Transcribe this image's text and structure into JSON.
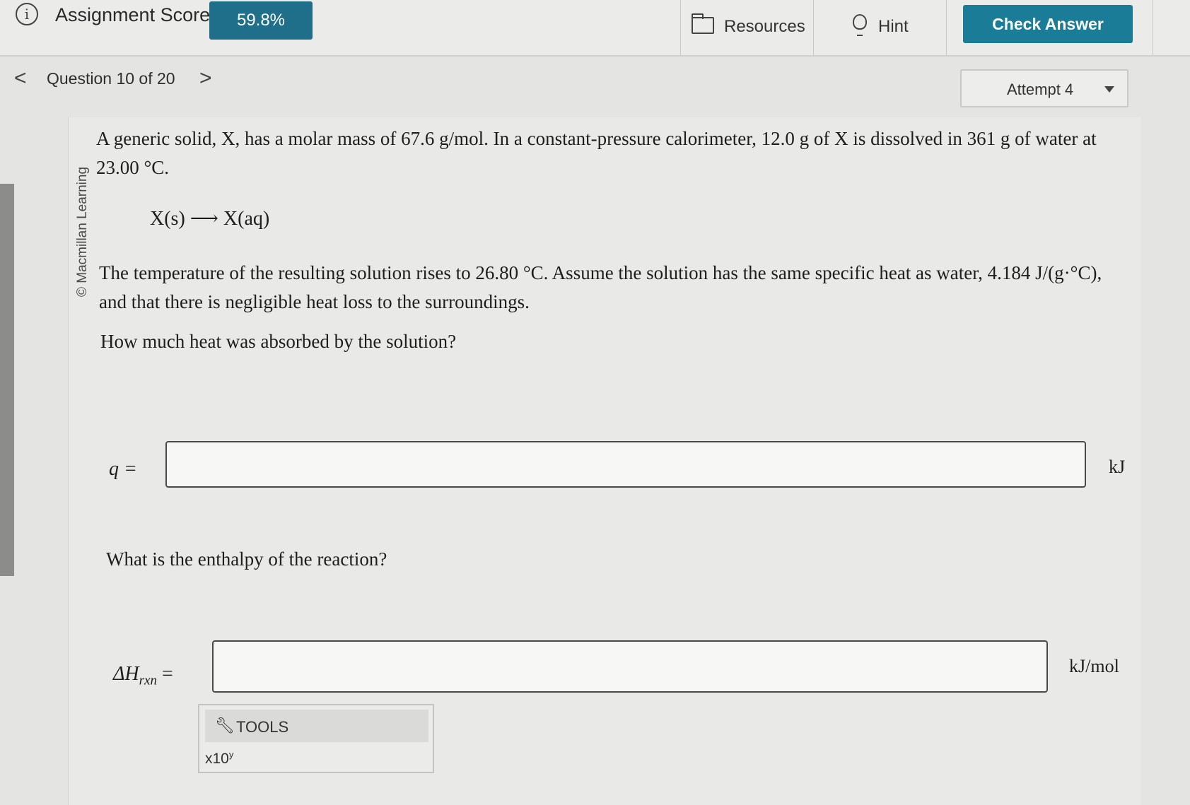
{
  "header": {
    "score_label": "Assignment Score:",
    "score_value": "59.8%",
    "resources_label": "Resources",
    "hint_label": "Hint",
    "check_answer_label": "Check Answer"
  },
  "nav": {
    "question_label": "Question 10 of 20",
    "prev_symbol": "<",
    "next_symbol": ">",
    "attempt_label": "Attempt 4"
  },
  "copyright": "© Macmillan Learning",
  "problem": {
    "intro": "A generic solid, X, has a molar mass of 67.6 g/mol. In a constant-pressure calorimeter, 12.0 g of X is dissolved in 361 g of water at 23.00 °C.",
    "equation": "X(s) ⟶ X(aq)",
    "details": "The temperature of the resulting solution rises to 26.80 °C. Assume the solution has the same specific heat as water, 4.184 J/(g·°C), and that there is negligible heat loss to the surroundings.",
    "question1": "How much heat was absorbed by the solution?",
    "question2": "What is the enthalpy of the reaction?"
  },
  "answers": {
    "q_label": "q =",
    "q_value": "",
    "q_unit": "kJ",
    "dh_symbol": "ΔH",
    "dh_subscript": "rxn",
    "dh_equals": "=",
    "dh_value": "",
    "dh_unit": "kJ/mol"
  },
  "tools": {
    "label": "TOOLS",
    "x10": "x10",
    "x10_sup": "y"
  },
  "icons": [
    "info-icon",
    "folder-icon",
    "lightbulb-icon",
    "chevron-left-icon",
    "chevron-right-icon",
    "caret-down-icon",
    "wrench-icon"
  ],
  "colors": {
    "score_badge": "#1f6f8b",
    "check_answer": "#1a7c97"
  }
}
